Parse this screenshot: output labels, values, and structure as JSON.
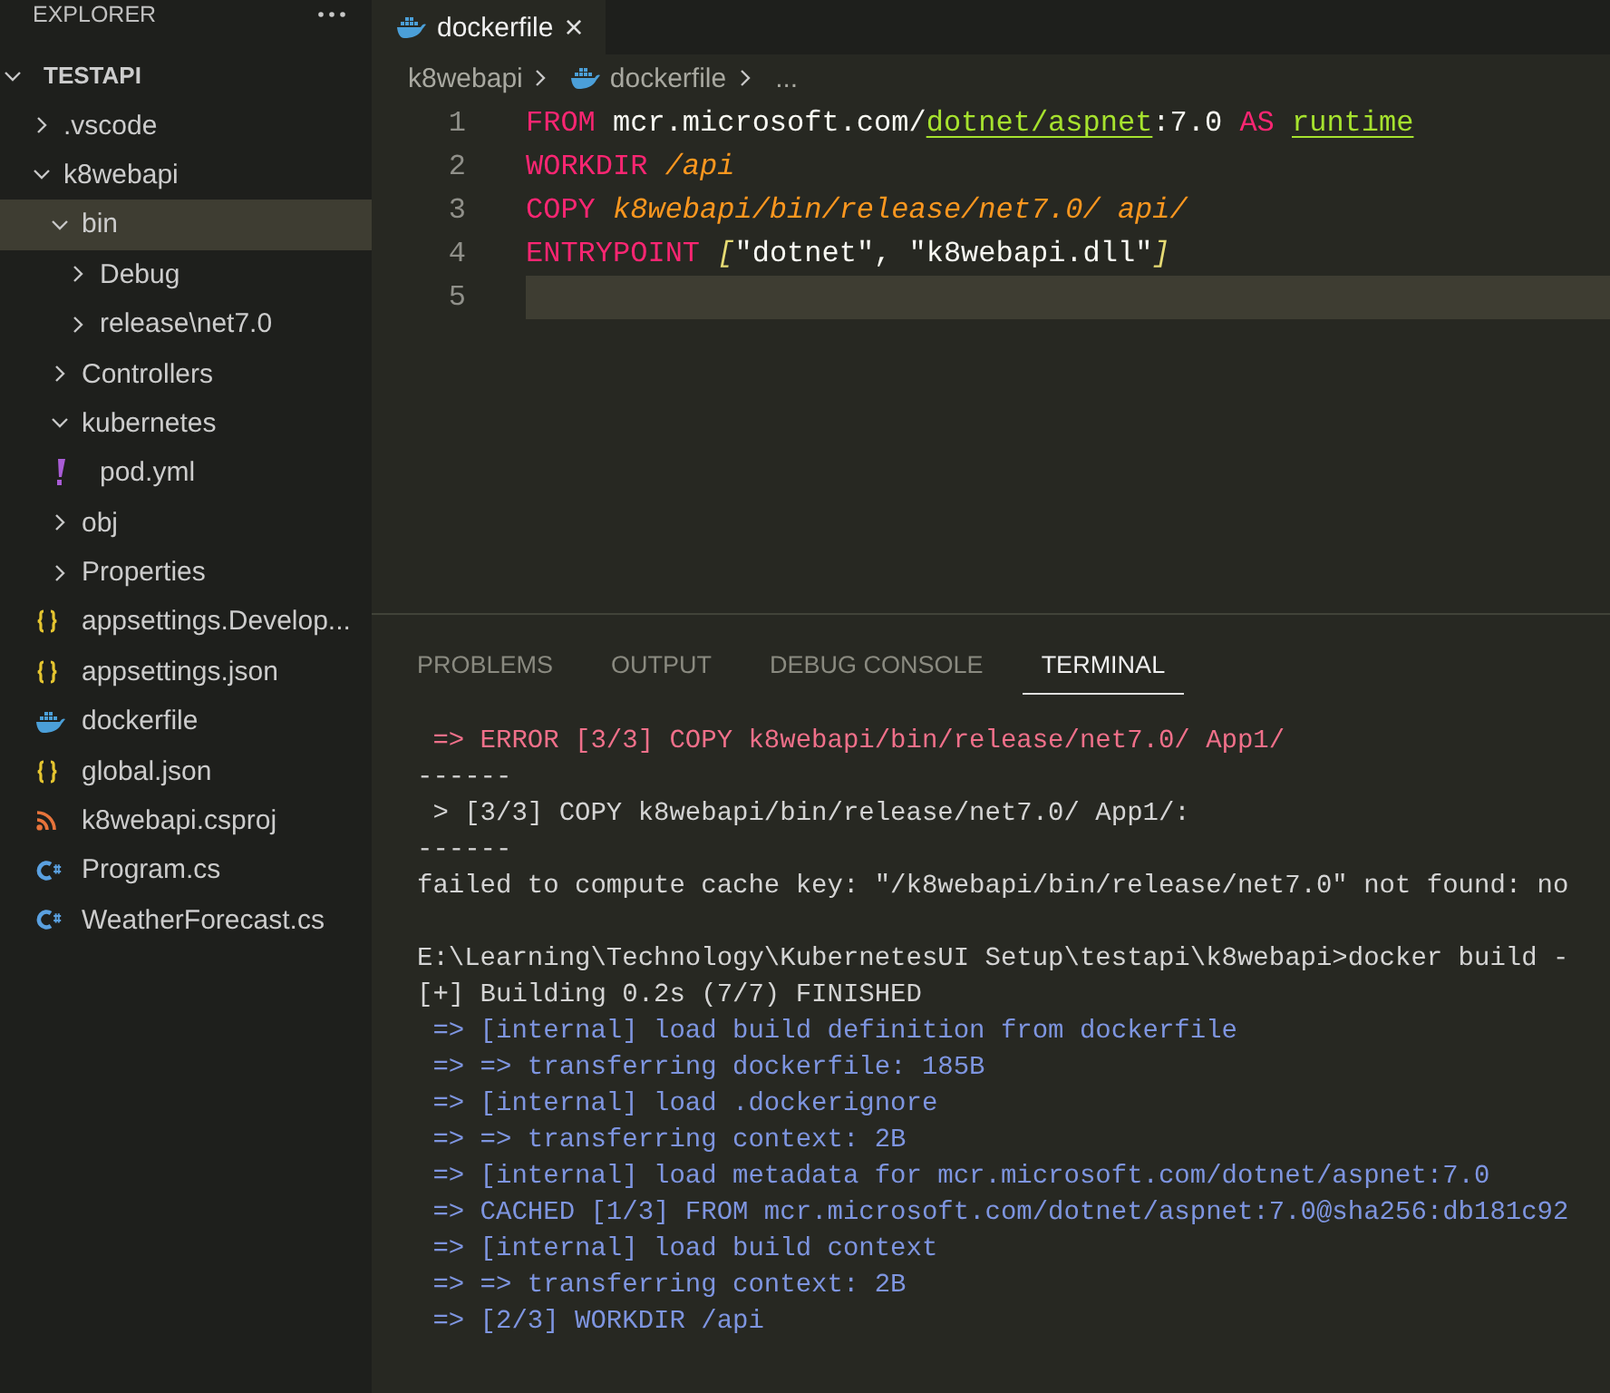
{
  "explorer": {
    "title": "EXPLORER",
    "root": {
      "label": "TESTAPI",
      "expanded": true,
      "children": [
        {
          "label": ".vscode",
          "kind": "folder",
          "expanded": false,
          "selected": false
        },
        {
          "label": "k8webapi",
          "kind": "folder",
          "expanded": true,
          "selected": false,
          "children": [
            {
              "label": "bin",
              "kind": "folder",
              "expanded": true,
              "selected": true,
              "children": [
                {
                  "label": "Debug",
                  "kind": "folder",
                  "expanded": false,
                  "selected": false
                },
                {
                  "label": "release\\net7.0",
                  "kind": "folder",
                  "expanded": false,
                  "selected": false
                }
              ]
            },
            {
              "label": "Controllers",
              "kind": "folder",
              "expanded": false,
              "selected": false
            },
            {
              "label": "kubernetes",
              "kind": "folder",
              "expanded": true,
              "selected": false,
              "children": [
                {
                  "label": "pod.yml",
                  "kind": "yaml",
                  "selected": false
                }
              ]
            },
            {
              "label": "obj",
              "kind": "folder",
              "expanded": false,
              "selected": false
            },
            {
              "label": "Properties",
              "kind": "folder",
              "expanded": false,
              "selected": false
            },
            {
              "label": "appsettings.Develop...",
              "kind": "json",
              "selected": false
            },
            {
              "label": "appsettings.json",
              "kind": "json",
              "selected": false
            },
            {
              "label": "dockerfile",
              "kind": "docker",
              "selected": false
            },
            {
              "label": "global.json",
              "kind": "json",
              "selected": false
            },
            {
              "label": "k8webapi.csproj",
              "kind": "rss",
              "selected": false
            },
            {
              "label": "Program.cs",
              "kind": "csharp",
              "selected": false
            },
            {
              "label": "WeatherForecast.cs",
              "kind": "csharp",
              "selected": false
            }
          ]
        }
      ]
    }
  },
  "editor_tabs": [
    {
      "label": "dockerfile",
      "selected": true,
      "close": "×"
    }
  ],
  "breadcrumb": [
    "k8webapi",
    "dockerfile",
    "..."
  ],
  "code_lines": [
    {
      "number": "1",
      "current": false,
      "tokens": [
        {
          "kind": "keyword",
          "text": "FROM"
        },
        {
          "kind": "text",
          "text": " mcr.microsoft.com/"
        },
        {
          "kind": "link",
          "text": "dotnet/aspnet"
        },
        {
          "kind": "text",
          "text": ":7.0 "
        },
        {
          "kind": "keyword",
          "text": "AS "
        },
        {
          "kind": "link",
          "text": "runtime"
        }
      ]
    },
    {
      "number": "2",
      "current": false,
      "tokens": [
        {
          "kind": "keyword",
          "text": "WORKDIR"
        },
        {
          "kind": "italic",
          "text": " /api"
        }
      ]
    },
    {
      "number": "3",
      "current": false,
      "tokens": [
        {
          "kind": "keyword",
          "text": "COPY"
        },
        {
          "kind": "italic",
          "text": " k8webapi/bin/release/net7.0/ api/"
        }
      ]
    },
    {
      "number": "4",
      "current": false,
      "tokens": [
        {
          "kind": "keyword",
          "text": "ENTRYPOINT "
        },
        {
          "kind": "bracket",
          "text": "["
        },
        {
          "kind": "text",
          "text": "\"dotnet\", \"k8webapi.dll\""
        },
        {
          "kind": "bracket",
          "text": "]"
        }
      ]
    },
    {
      "number": "5",
      "current": true
    }
  ],
  "panel_tabs": [
    {
      "label": "PROBLEMS",
      "selected": false
    },
    {
      "label": "OUTPUT",
      "selected": false
    },
    {
      "label": "DEBUG CONSOLE",
      "selected": false
    },
    {
      "label": "TERMINAL",
      "selected": true
    }
  ],
  "terminal_lines": [
    {
      "kind": "error",
      "text": " => ERROR [3/3] COPY k8webapi/bin/release/net7.0/ App1/"
    },
    {
      "kind": "plain",
      "text": "------"
    },
    {
      "kind": "plain",
      "text": " > [3/3] COPY k8webapi/bin/release/net7.0/ App1/:"
    },
    {
      "kind": "plain",
      "text": "------"
    },
    {
      "kind": "plain",
      "text": "failed to compute cache key: \"/k8webapi/bin/release/net7.0\" not found: no"
    },
    {
      "kind": "blank"
    },
    {
      "kind": "plain",
      "text": "E:\\Learning\\Technology\\KubernetesUI Setup\\testapi\\k8webapi>docker build -"
    },
    {
      "kind": "plain",
      "text": "[+] Building 0.2s (7/7) FINISHED"
    },
    {
      "kind": "info",
      "text": " => [internal] load build definition from dockerfile"
    },
    {
      "kind": "info",
      "text": " => => transferring dockerfile: 185B"
    },
    {
      "kind": "info",
      "text": " => [internal] load .dockerignore"
    },
    {
      "kind": "info",
      "text": " => => transferring context: 2B"
    },
    {
      "kind": "info",
      "text": " => [internal] load metadata for mcr.microsoft.com/dotnet/aspnet:7.0"
    },
    {
      "kind": "info",
      "text": " => CACHED [1/3] FROM mcr.microsoft.com/dotnet/aspnet:7.0@sha256:db181c92"
    },
    {
      "kind": "info",
      "text": " => [internal] load build context"
    },
    {
      "kind": "info",
      "text": " => => transferring context: 2B"
    },
    {
      "kind": "info",
      "text": " => [2/3] WORKDIR /api"
    }
  ]
}
